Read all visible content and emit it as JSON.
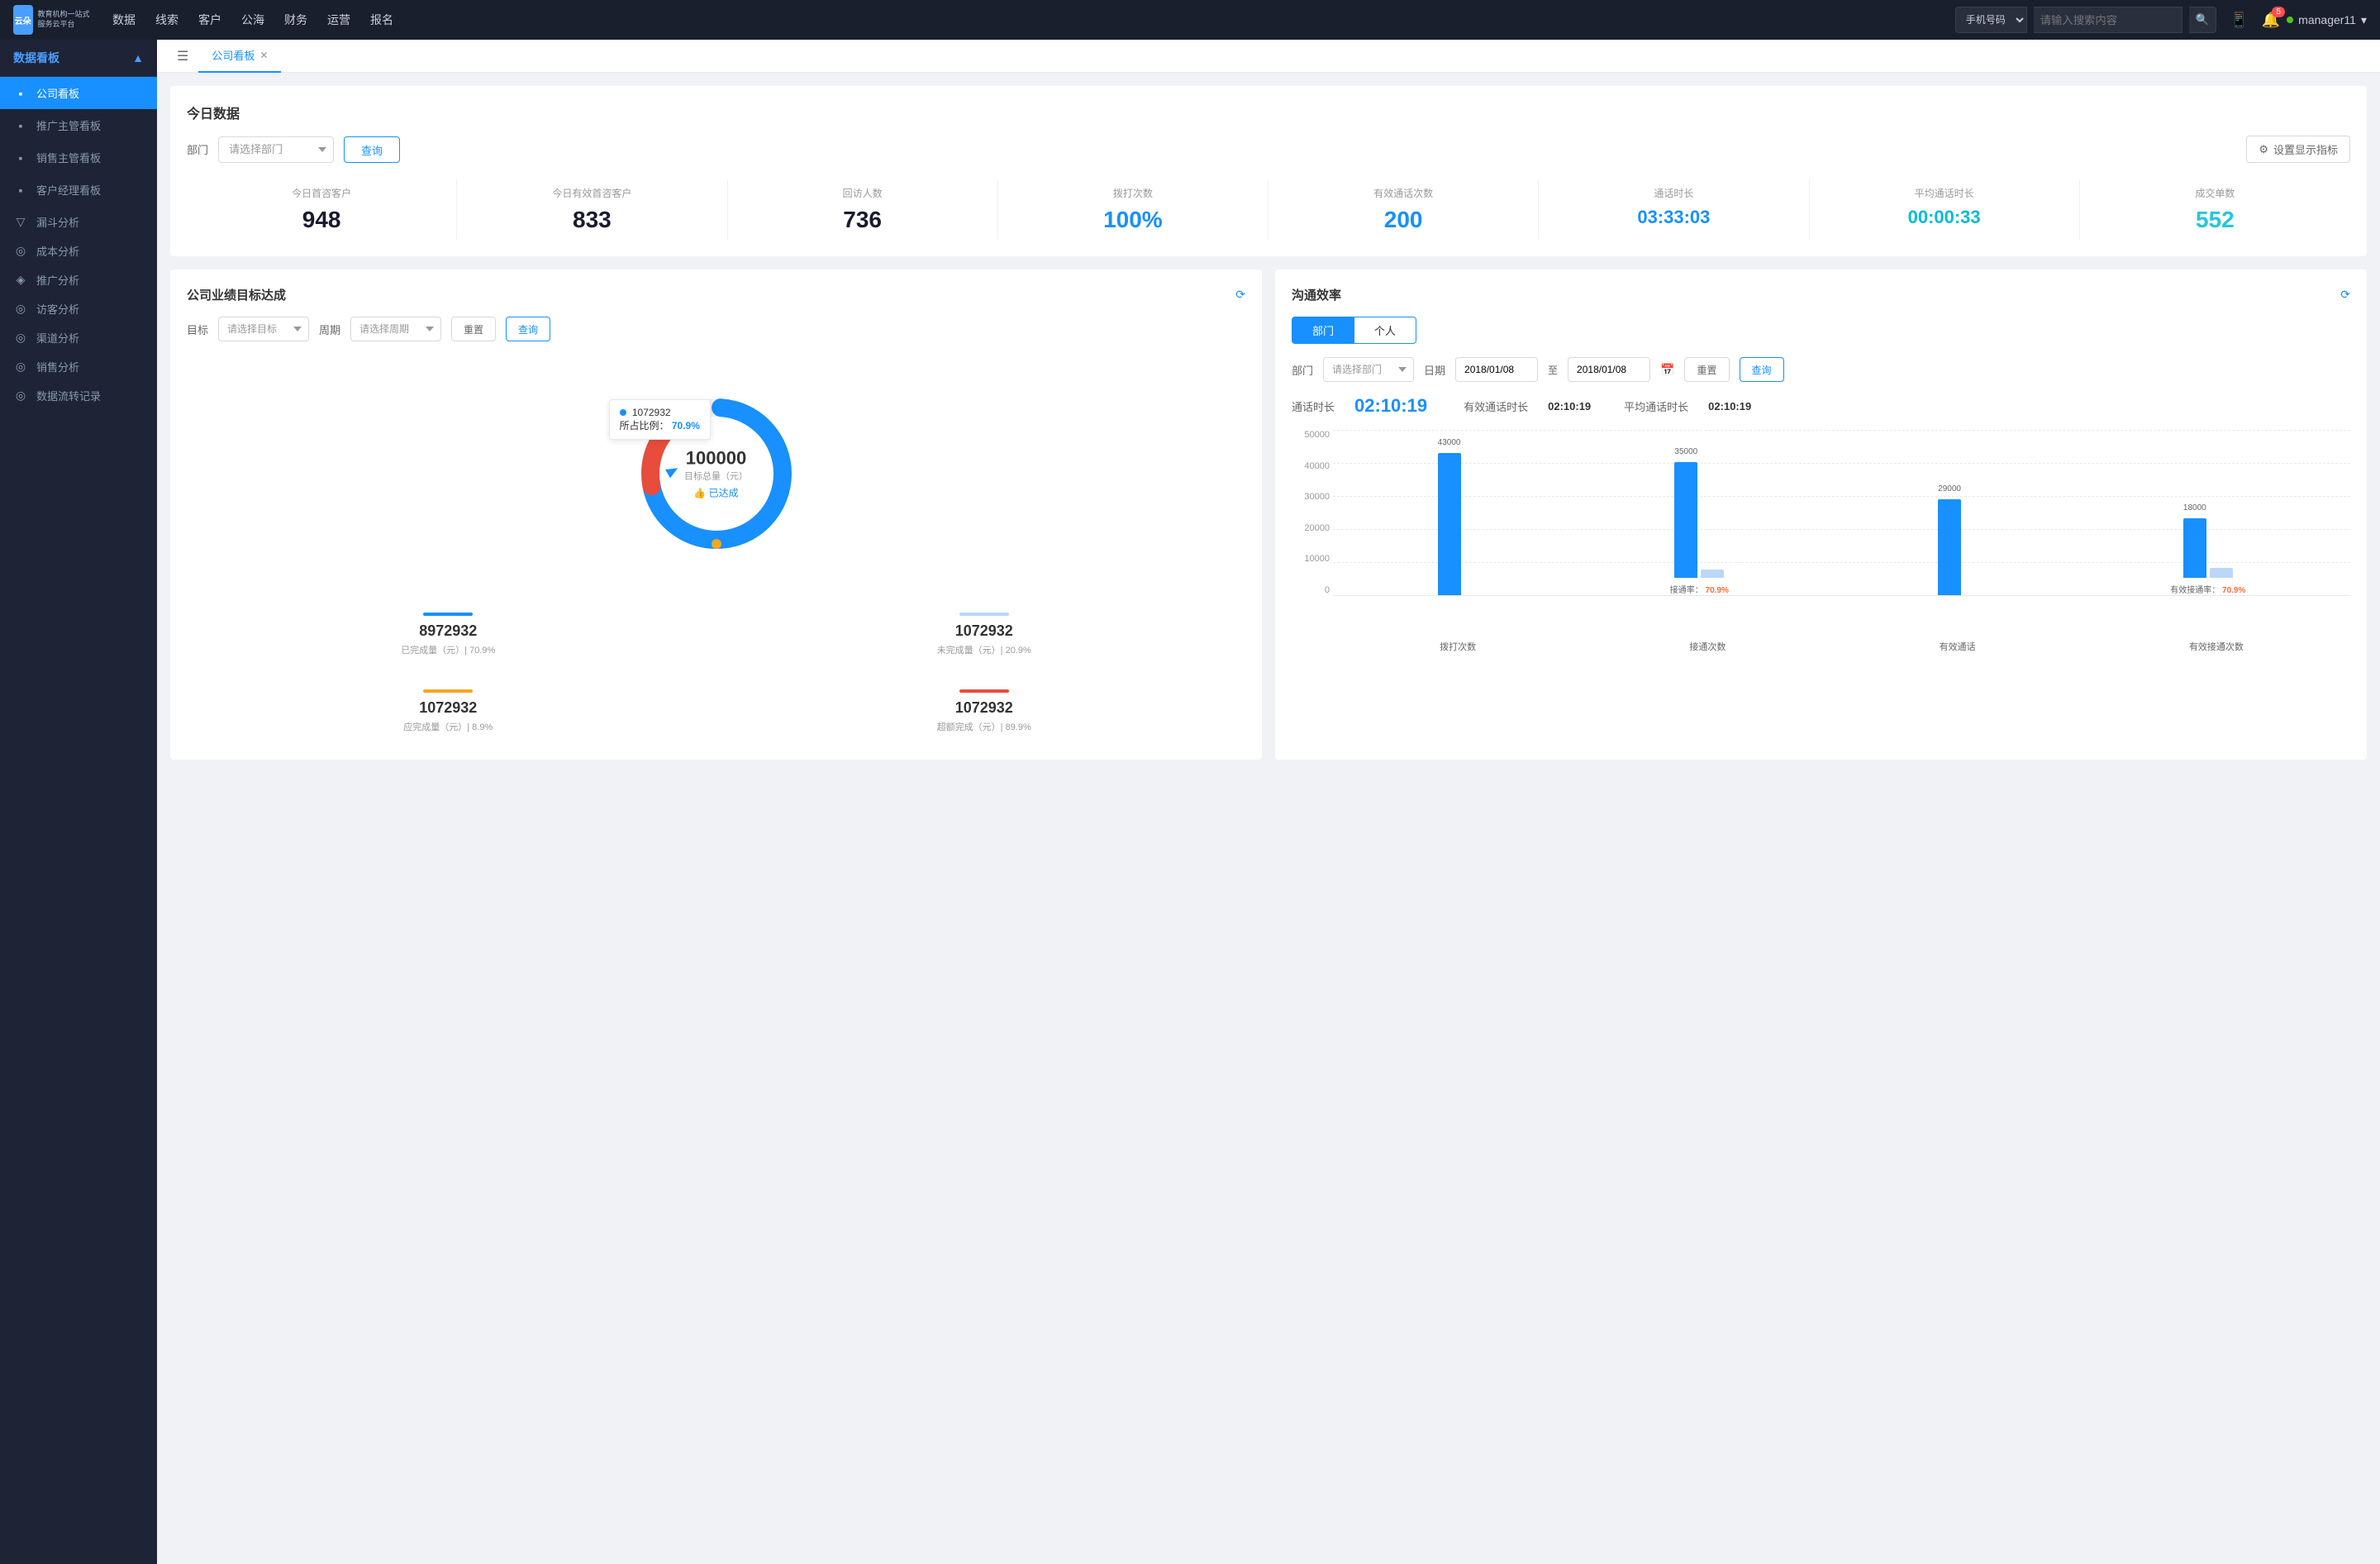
{
  "topNav": {
    "logo": {
      "line1": "云朵CRM",
      "line2": "教育机构一站式服务云平台"
    },
    "items": [
      "数据",
      "线索",
      "客户",
      "公海",
      "财务",
      "运营",
      "报名"
    ],
    "searchPlaceholder": "请输入搜索内容",
    "searchType": "手机号码",
    "badgeCount": "5",
    "username": "manager11"
  },
  "sidebar": {
    "groupLabel": "数据看板",
    "items": [
      {
        "label": "公司看板",
        "active": true
      },
      {
        "label": "推广主管看板",
        "active": false
      },
      {
        "label": "销售主管看板",
        "active": false
      },
      {
        "label": "客户经理看板",
        "active": false
      }
    ],
    "groups": [
      {
        "label": "漏斗分析"
      },
      {
        "label": "成本分析"
      },
      {
        "label": "推广分析"
      },
      {
        "label": "访客分析"
      },
      {
        "label": "渠道分析"
      },
      {
        "label": "销售分析"
      },
      {
        "label": "数据流转记录"
      }
    ]
  },
  "tabs": [
    {
      "label": "公司看板",
      "active": true
    }
  ],
  "todaySection": {
    "title": "今日数据",
    "filterLabel": "部门",
    "filterPlaceholder": "请选择部门",
    "queryBtn": "查询",
    "settingsBtn": "设置显示指标",
    "stats": [
      {
        "label": "今日首咨客户",
        "value": "948",
        "color": "dark"
      },
      {
        "label": "今日有效首咨客户",
        "value": "833",
        "color": "dark"
      },
      {
        "label": "回访人数",
        "value": "736",
        "color": "dark"
      },
      {
        "label": "拨打次数",
        "value": "100%",
        "color": "blue"
      },
      {
        "label": "有效通话次数",
        "value": "200",
        "color": "blue"
      },
      {
        "label": "通话时长",
        "value": "03:33:03",
        "color": "blue"
      },
      {
        "label": "平均通话时长",
        "value": "00:00:33",
        "color": "cyan"
      },
      {
        "label": "成交单数",
        "value": "552",
        "color": "teal"
      }
    ]
  },
  "goalPanel": {
    "title": "公司业绩目标达成",
    "goalLabel": "目标",
    "goalPlaceholder": "请选择目标",
    "periodLabel": "周期",
    "periodPlaceholder": "请选择周期",
    "resetBtn": "重置",
    "queryBtn": "查询",
    "donut": {
      "centerValue": "100000",
      "centerLabel": "目标总量（元）",
      "centerSublabel": "👍 已达成",
      "tooltipValue": "1072932",
      "tooltipPercent": "70.9%",
      "tooltipLabel": "所占比例："
    },
    "stats": [
      {
        "value": "8972932",
        "label": "已完成量（元）| 70.9%",
        "barColor": "#1890ff"
      },
      {
        "value": "1072932",
        "label": "未完成量（元）| 20.9%",
        "barColor": "#bbd6f8"
      },
      {
        "value": "1072932",
        "label": "应完成量（元）| 8.9%",
        "barColor": "#f5a623"
      },
      {
        "value": "1072932",
        "label": "超额完成（元）| 89.9%",
        "barColor": "#e74c3c"
      }
    ]
  },
  "commPanel": {
    "title": "沟通效率",
    "tabs": [
      "部门",
      "个人"
    ],
    "activeTab": "部门",
    "filterLabel": "部门",
    "filterPlaceholder": "请选择部门",
    "dateLabel": "日期",
    "dateFrom": "2018/01/08",
    "dateTo": "2018/01/08",
    "resetBtn": "重置",
    "queryBtn": "查询",
    "callDuration": {
      "label": "通话时长",
      "value": "02:10:19"
    },
    "effectiveDuration": {
      "label": "有效通话时长",
      "value": "02:10:19"
    },
    "avgDuration": {
      "label": "平均通话时长",
      "value": "02:10:19"
    },
    "chart": {
      "yLabels": [
        "50000",
        "40000",
        "30000",
        "20000",
        "10000",
        "0"
      ],
      "groups": [
        {
          "xLabel": "拨打次数",
          "bars": [
            {
              "value": 43000,
              "label": "43000",
              "color": "blue",
              "heightPct": 86
            },
            {
              "value": 0,
              "label": "",
              "color": "lightblue",
              "heightPct": 0
            }
          ]
        },
        {
          "xLabel": "接通次数",
          "rateLabel": "接通率：",
          "rateValue": "70.9%",
          "bars": [
            {
              "value": 35000,
              "label": "35000",
              "color": "blue",
              "heightPct": 70
            },
            {
              "value": 0,
              "label": "",
              "color": "lightblue",
              "heightPct": 0
            }
          ]
        },
        {
          "xLabel": "有效通话",
          "bars": [
            {
              "value": 29000,
              "label": "29000",
              "color": "blue",
              "heightPct": 58
            },
            {
              "value": 0,
              "label": "",
              "color": "lightblue",
              "heightPct": 0
            }
          ]
        },
        {
          "xLabel": "有效接通次数",
          "rateLabel": "有效接通率：",
          "rateValue": "70.9%",
          "bars": [
            {
              "value": 18000,
              "label": "18000",
              "color": "blue",
              "heightPct": 36
            },
            {
              "value": 3000,
              "label": "",
              "color": "lightblue",
              "heightPct": 6
            }
          ]
        }
      ]
    }
  }
}
